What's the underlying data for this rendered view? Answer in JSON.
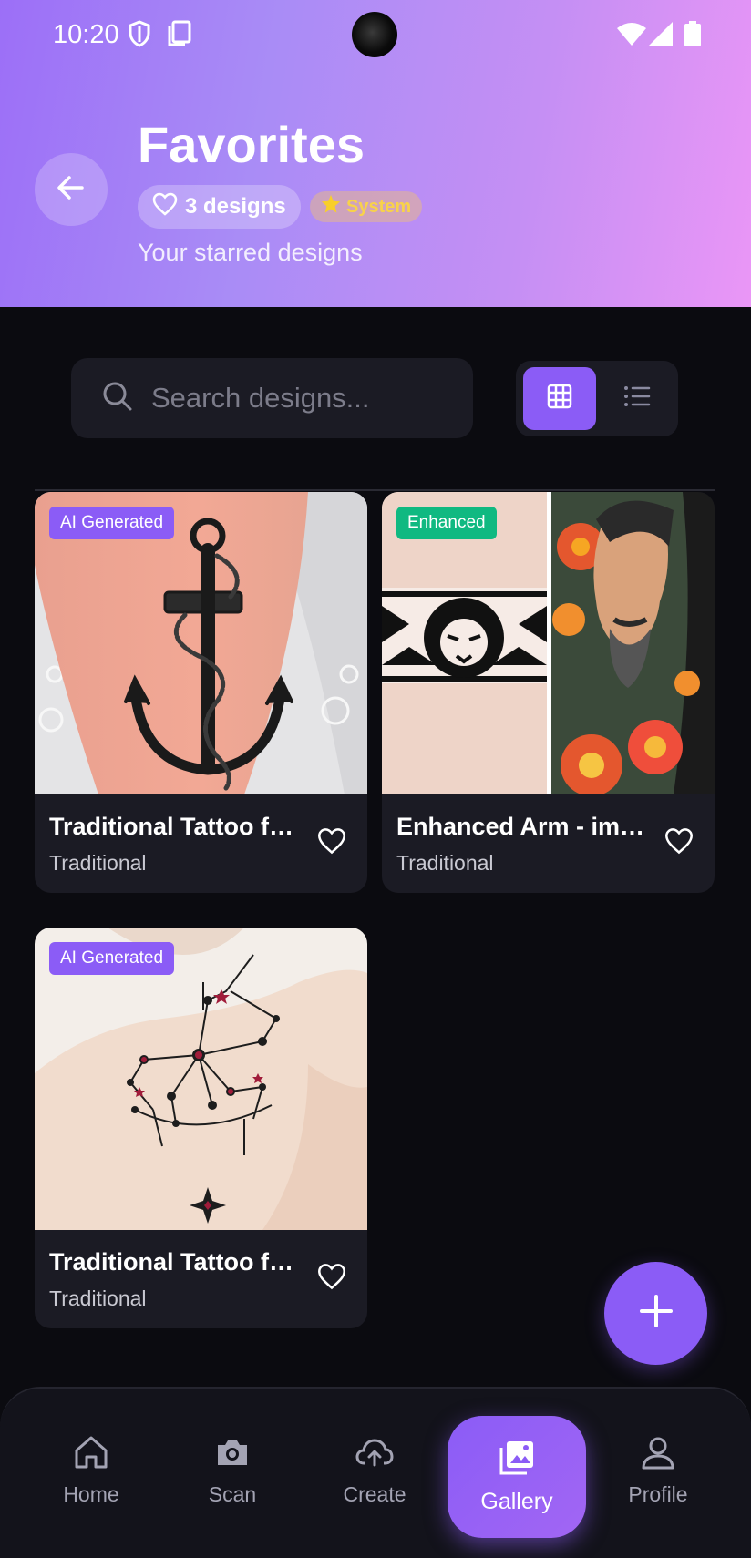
{
  "status_bar": {
    "time": "10:20"
  },
  "header": {
    "title": "Favorites",
    "count_label": "3 designs",
    "system_label": "System",
    "subtitle": "Your starred designs"
  },
  "search": {
    "placeholder": "Search designs..."
  },
  "designs": [
    {
      "title": "Traditional Tattoo for...",
      "category": "Traditional",
      "badge": "AI Generated"
    },
    {
      "title": "Enhanced Arm - impr...",
      "category": "Traditional",
      "badge": "Enhanced"
    },
    {
      "title": "Traditional Tattoo for...",
      "category": "Traditional",
      "badge": "AI Generated"
    }
  ],
  "nav": {
    "items": [
      {
        "label": "Home",
        "icon": "home-icon"
      },
      {
        "label": "Scan",
        "icon": "camera-icon"
      },
      {
        "label": "Create",
        "icon": "cloud-upload-icon"
      },
      {
        "label": "Gallery",
        "icon": "gallery-icon"
      },
      {
        "label": "Profile",
        "icon": "user-icon"
      }
    ],
    "active": "Gallery"
  },
  "colors": {
    "accent": "#8b5cf6",
    "enhanced_badge": "#10b981",
    "background": "#0b0b10",
    "card": "#1b1b24"
  }
}
